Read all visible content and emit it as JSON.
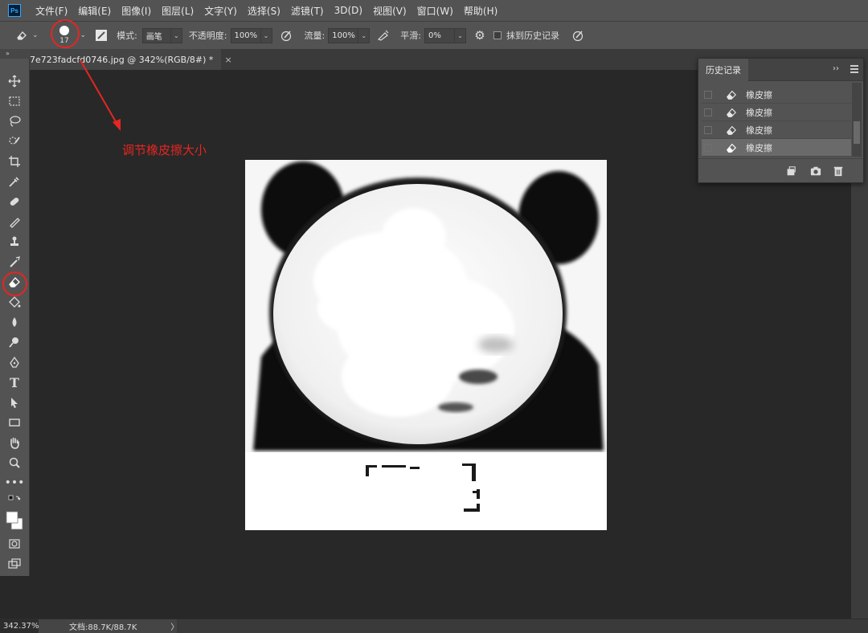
{
  "app": {
    "logo_text": "Ps"
  },
  "menu": [
    "文件(F)",
    "编辑(E)",
    "图像(I)",
    "图层(L)",
    "文字(Y)",
    "选择(S)",
    "滤镜(T)",
    "3D(D)",
    "视图(V)",
    "窗口(W)",
    "帮助(H)"
  ],
  "options": {
    "brush_size": "17",
    "mode_label": "模式:",
    "mode_value": "画笔",
    "opacity_label": "不透明度:",
    "opacity_value": "100%",
    "flow_label": "流量:",
    "flow_value": "100%",
    "smooth_label": "平滑:",
    "smooth_value": "0%",
    "erase_history_label": "抹到历史记录",
    "erase_history_checked": false
  },
  "document": {
    "tab_title": "7e723fadcfd0746.jpg @ 342%(RGB/8#) *",
    "close_glyph": "×"
  },
  "annotation": {
    "text": "调节橡皮擦大小",
    "color": "#e52622"
  },
  "history": {
    "title": "历史记录",
    "expand": "››",
    "items": [
      {
        "label": "橡皮擦"
      },
      {
        "label": "橡皮擦"
      },
      {
        "label": "橡皮擦"
      },
      {
        "label": "橡皮擦"
      }
    ]
  },
  "status": {
    "zoom": "342.37%",
    "doc_info": "文档:88.7K/88.7K",
    "arrow": "〉"
  },
  "toolbar": {
    "collapse": "» ",
    "tools": [
      "move-tool",
      "marquee-tool",
      "lasso-tool",
      "quick-select-tool",
      "crop-tool",
      "eyedropper-tool",
      "healing-brush-tool",
      "brush-tool",
      "clone-stamp-tool",
      "history-brush-tool",
      "eraser-tool",
      "paint-bucket-tool",
      "blur-tool",
      "dodge-tool",
      "pen-tool",
      "type-tool",
      "path-select-tool",
      "rectangle-tool",
      "hand-tool",
      "zoom-tool",
      "more-tools",
      "swap-colors",
      "color-swatches",
      "quick-mask",
      "screen-mode"
    ]
  },
  "colors": {
    "accent_red": "#e52622",
    "panel": "#535353",
    "workspace": "#282828"
  }
}
